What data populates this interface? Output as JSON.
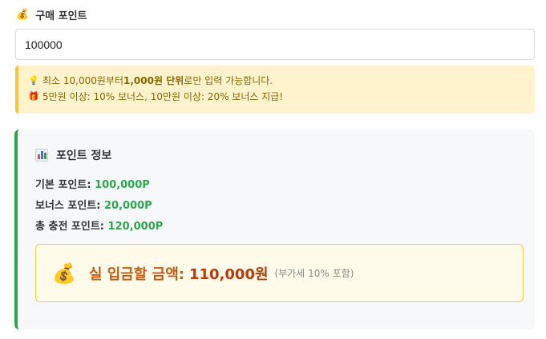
{
  "purchase": {
    "icon": "money-bag-icon",
    "label": "구매 포인트",
    "value": "100000"
  },
  "notice": {
    "line1_prefix": "최소 10,000원부터 ",
    "line1_bold": "1,000원 단위",
    "line1_suffix": "로만 입력 가능합니다.",
    "line2": "5만원 이상: 10% 보너스, 10만원 이상: 20% 보너스 지급!",
    "line1_icon": "lightbulb-icon",
    "line2_icon": "gift-icon"
  },
  "info": {
    "title": "포인트 정보",
    "title_icon": "bar-chart-icon",
    "base_label": "기본 포인트: ",
    "base_value": "100,000P",
    "bonus_label": "보너스 포인트: ",
    "bonus_value": "20,000P",
    "total_label": "총 충전 포인트: ",
    "total_value": "120,000P"
  },
  "payment": {
    "icon": "money-bag-icon",
    "label": "실 입금할 금액:",
    "amount": "110,000원",
    "note": "(부가세 10% 포함)"
  },
  "colors": {
    "accent_green": "#2ea44f",
    "notice_bg": "#fff3cd",
    "pay_text": "#c55a11"
  }
}
